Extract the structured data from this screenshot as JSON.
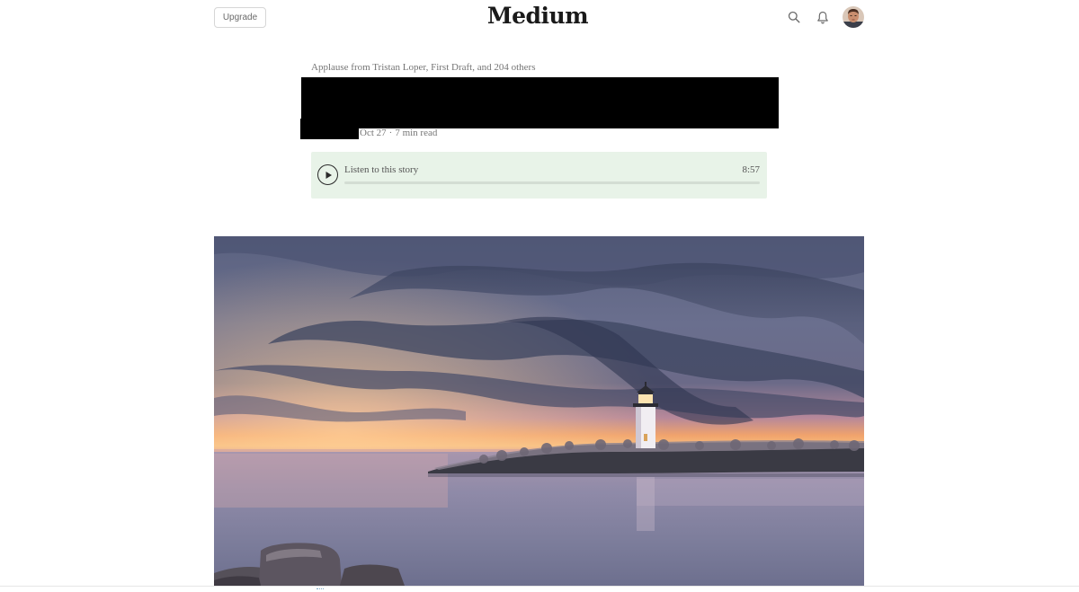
{
  "header": {
    "upgrade_label": "Upgrade",
    "logo_text": "Medium",
    "icons": [
      "search-icon",
      "bell-icon",
      "avatar"
    ]
  },
  "article": {
    "applause_text": "Applause from Tristan Loper, First Draft, and 204 others",
    "date": "Oct 27",
    "separator": "·",
    "read_time": "7 min read"
  },
  "audio": {
    "label": "Listen to this story",
    "duration": "8:57",
    "progress": 0,
    "background_color": "#e8f3e8"
  },
  "colors": {
    "text": "#292929",
    "muted": "#757575",
    "redaction": "#000000"
  }
}
